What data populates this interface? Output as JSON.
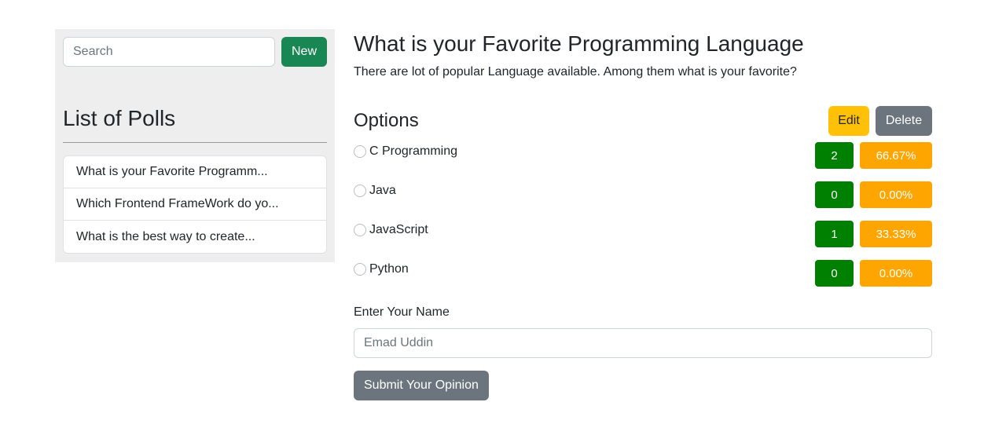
{
  "sidebar": {
    "search_placeholder": "Search",
    "new_label": "New",
    "heading": "List of Polls",
    "polls": [
      "What is your Favorite Programm...",
      "Which Frontend FrameWork do yo...",
      "What is the best way to create..."
    ]
  },
  "poll": {
    "title": "What is your Favorite Programming Language",
    "description": "There are lot of popular Language available. Among them what is your favorite?",
    "options_heading": "Options",
    "edit_label": "Edit",
    "delete_label": "Delete",
    "options": [
      {
        "label": "C Programming",
        "count": "2",
        "percent": "66.67%"
      },
      {
        "label": "Java",
        "count": "0",
        "percent": "0.00%"
      },
      {
        "label": "JavaScript",
        "count": "1",
        "percent": "33.33%"
      },
      {
        "label": "Python",
        "count": "0",
        "percent": "0.00%"
      }
    ],
    "name_label": "Enter Your Name",
    "name_placeholder": "Emad Uddin",
    "submit_label": "Submit Your Opinion"
  },
  "colors": {
    "new_button": "#198754",
    "edit_button": "#ffc107",
    "delete_button": "#6c757d",
    "count_badge": "#008000",
    "percent_badge": "#ffa500",
    "sidebar_bg": "#eeeeee"
  }
}
